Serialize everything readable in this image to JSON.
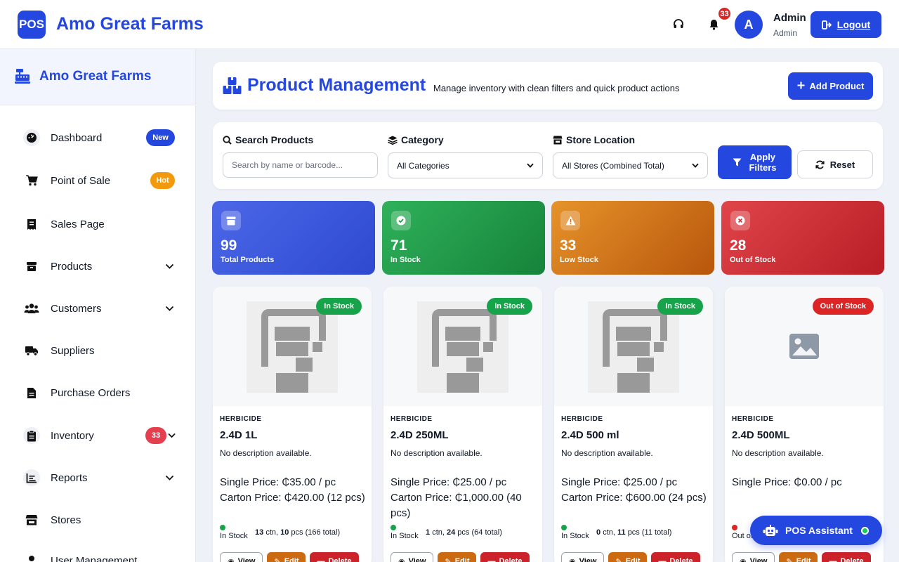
{
  "topbar": {
    "logo_text": "POS",
    "brand": "Amo Great Farms",
    "notification_count": "33",
    "avatar_initial": "A",
    "user_name": "Admin",
    "user_role": "Admin",
    "logout_label": "Logout"
  },
  "sidebar": {
    "brand": "Amo Great Farms",
    "items": [
      {
        "label": "Dashboard",
        "icon": "tachometer-icon",
        "badge": "New"
      },
      {
        "label": "Point of Sale",
        "icon": "cart-icon",
        "badge": "Hot"
      },
      {
        "label": "Sales Page",
        "icon": "receipt-icon"
      },
      {
        "label": "Products",
        "icon": "box-icon"
      },
      {
        "label": "Customers",
        "icon": "users-icon"
      },
      {
        "label": "Suppliers",
        "icon": "truck-icon"
      },
      {
        "label": "Purchase Orders",
        "icon": "file-icon"
      },
      {
        "label": "Inventory",
        "icon": "clipboard-icon",
        "badge": "33"
      },
      {
        "label": "Reports",
        "icon": "chart-icon"
      },
      {
        "label": "Stores",
        "icon": "store-icon"
      },
      {
        "label": "User Management",
        "icon": "user-icon"
      }
    ]
  },
  "header": {
    "title": "Product Management",
    "subtitle": "Manage inventory with clean filters and quick product actions",
    "add_label": "Add Product"
  },
  "filters": {
    "search_label": "Search Products",
    "search_placeholder": "Search by name or barcode...",
    "category_label": "Category",
    "category_value": "All Categories",
    "store_label": "Store Location",
    "store_value": "All Stores (Combined Total)",
    "apply_line1": "Apply",
    "apply_line2": "Filters",
    "reset_label": "Reset"
  },
  "stats": [
    {
      "value": "99",
      "label": "Total Products"
    },
    {
      "value": "71",
      "label": "In Stock"
    },
    {
      "value": "33",
      "label": "Low Stock"
    },
    {
      "value": "28",
      "label": "Out of Stock"
    }
  ],
  "products": [
    {
      "badge": "In Stock",
      "category": "HERBICIDE",
      "name": "2.4D 1L",
      "desc": "No description available.",
      "single": "Single Price: ₵35.00 / pc",
      "carton": "Carton Price: ₵420.00 (12 pcs)",
      "stock_status": "In Stock",
      "ctn": "13",
      "pcs": "10",
      "total": "(166 total)"
    },
    {
      "badge": "In Stock",
      "category": "HERBICIDE",
      "name": "2.4D 250ML",
      "desc": "No description available.",
      "single": "Single Price: ₵25.00 / pc",
      "carton": "Carton Price: ₵1,000.00 (40 pcs)",
      "stock_status": "In Stock",
      "ctn": "1",
      "pcs": "24",
      "total": "(64 total)"
    },
    {
      "badge": "In Stock",
      "category": "HERBICIDE",
      "name": "2.4D 500 ml",
      "desc": "No description available.",
      "single": "Single Price: ₵25.00 / pc",
      "carton": "Carton Price: ₵600.00 (24 pcs)",
      "stock_status": "In Stock",
      "ctn": "0",
      "pcs": "11",
      "total": "(11 total)"
    },
    {
      "badge": "Out of Stock",
      "category": "HERBICIDE",
      "name": "2.4D 500ML",
      "desc": "No description available.",
      "single": "Single Price: ₵0.00 / pc",
      "carton": "",
      "stock_status": "Out of Stock",
      "ctn": "",
      "pcs": "",
      "total": ""
    }
  ],
  "actions": {
    "view": "View",
    "edit": "Edit",
    "delete": "Delete"
  },
  "units": {
    "ctn": "ctn,",
    "pcs": "pcs"
  },
  "assistant_label": "POS Assistant",
  "colors": {
    "primary": "#2447e0",
    "success": "#16a34a",
    "warning": "#d97706",
    "danger": "#dc2626"
  }
}
